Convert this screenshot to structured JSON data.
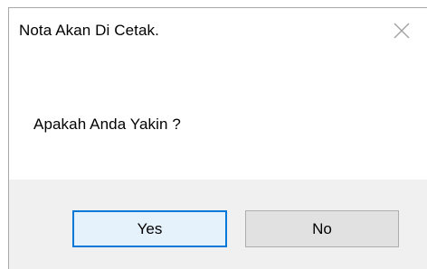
{
  "dialog": {
    "title": "Nota Akan Di Cetak.",
    "message": "Apakah Anda Yakin ?",
    "close_icon": "close-icon",
    "buttons": {
      "yes_label": "Yes",
      "no_label": "No"
    }
  },
  "colors": {
    "background": "#ffffff",
    "footer": "#f0f0f0",
    "button_face": "#e1e1e1",
    "default_button_border": "#0078d7",
    "default_button_face": "#e5f1fb"
  }
}
